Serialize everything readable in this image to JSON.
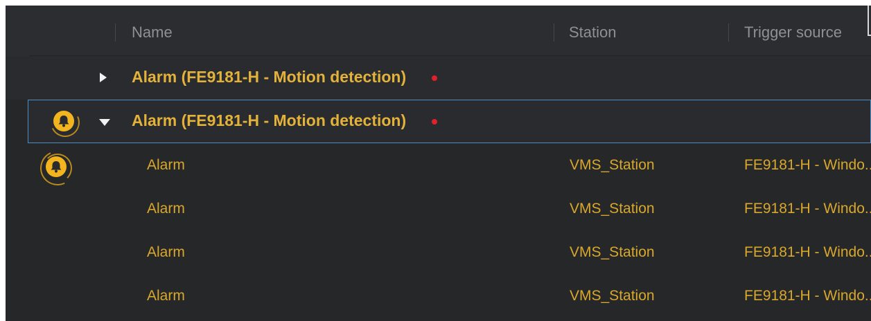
{
  "table": {
    "columns": {
      "name": "Name",
      "station": "Station",
      "trigger": "Trigger source"
    },
    "groups": [
      {
        "title": "Alarm (FE9181-H - Motion detection)",
        "expanded": false,
        "unread": true
      },
      {
        "title": "Alarm (FE9181-H - Motion detection)",
        "expanded": true,
        "unread": true,
        "selected": true
      }
    ],
    "rows": [
      {
        "name": "Alarm",
        "station": "VMS_Station",
        "trigger": "FE9181-H - Windo..."
      },
      {
        "name": "Alarm",
        "station": "VMS_Station",
        "trigger": "FE9181-H - Windo..."
      },
      {
        "name": "Alarm",
        "station": "VMS_Station",
        "trigger": "FE9181-H - Windo..."
      },
      {
        "name": "Alarm",
        "station": "VMS_Station",
        "trigger": "FE9181-H - Windo..."
      }
    ]
  },
  "icons": {
    "expand": "triangle-right-icon",
    "collapse": "triangle-down-icon",
    "alarm": "bell-icon",
    "unread": "red-dot-icon"
  },
  "colors": {
    "background": "#262729",
    "header_text": "#8e9094",
    "group_text": "#e2b23a",
    "row_text": "#d8a72c",
    "badge": "#f2b51f",
    "unread_dot": "#e0202a",
    "selection_border": "#4d8fc4"
  }
}
